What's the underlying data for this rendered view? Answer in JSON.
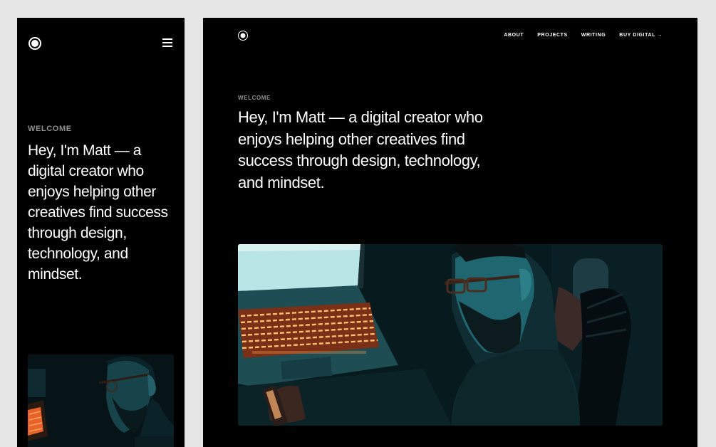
{
  "mobile": {
    "eyebrow": "WELCOME",
    "headline": "Hey, I'm Matt — a digital creator who enjoys helping other creatives find success through design, technology, and mindset."
  },
  "desktop": {
    "nav": {
      "about": "ABOUT",
      "projects": "PROJECTS",
      "writing": "WRITING",
      "buy_digital": "BUY DIGITAL →"
    },
    "eyebrow": "WELCOME",
    "headline": "Hey, I'm Matt — a digital creator who enjoys helping other creatives find success through design, technology, and mindset."
  },
  "icons": {
    "logo": "circle-dot-icon",
    "menu": "hamburger-menu-icon"
  },
  "colors": {
    "background": "#e6e6e6",
    "frame": "#000000",
    "text": "#ffffff",
    "eyebrow": "#8f8f8f"
  }
}
